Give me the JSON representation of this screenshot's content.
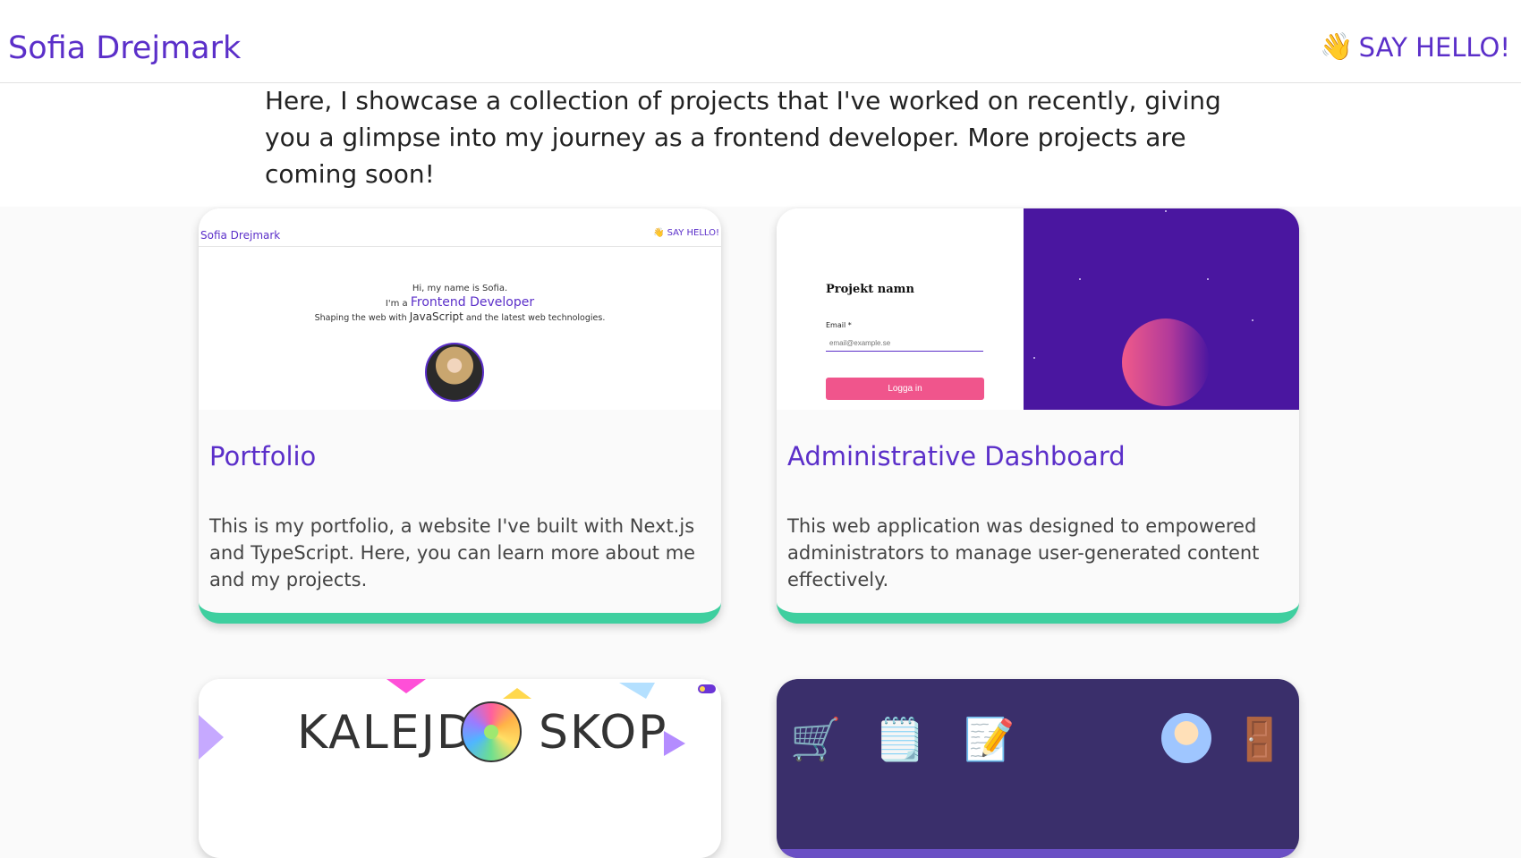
{
  "header": {
    "brand": "Sofia Drejmark",
    "hello_emoji": "👋",
    "hello_label": "SAY HELLO!"
  },
  "intro": "Here, I showcase a collection of projects that I've worked on recently, giving you a glimpse into my journey as a frontend developer. More projects are coming soon!",
  "projects": [
    {
      "title": "Portfolio",
      "description": "This is my portfolio, a website I've built with Next.js and TypeScript. Here, you can learn more about me and my projects.",
      "thumb": {
        "brand": "Sofia Drejmark",
        "hello": "👋 SAY HELLO!",
        "line1": "Hi, my name is Sofia.",
        "line2_prefix": "I'm a ",
        "line2_role": "Frontend Developer",
        "line3_a": "Shaping the web with ",
        "line3_js": "JavaScript",
        "line3_b": " and the latest web technologies."
      }
    },
    {
      "title": "Administrative Dashboard",
      "description": "This web application was designed to empowered administrators to manage user-generated content effectively.",
      "thumb": {
        "project_name": "Projekt namn",
        "email_label": "Email *",
        "email_placeholder": "email@example.se",
        "login_label": "Logga in"
      }
    },
    {
      "thumb": {
        "title_left": "KALEJD",
        "title_right": "SKOP"
      }
    },
    {
      "thumb": {}
    }
  ],
  "colors": {
    "accent": "#5b2fc9",
    "card_bottom": "#3ecf9f",
    "login_button": "#f0558c",
    "dashboard_bg": "#4a16a0"
  }
}
